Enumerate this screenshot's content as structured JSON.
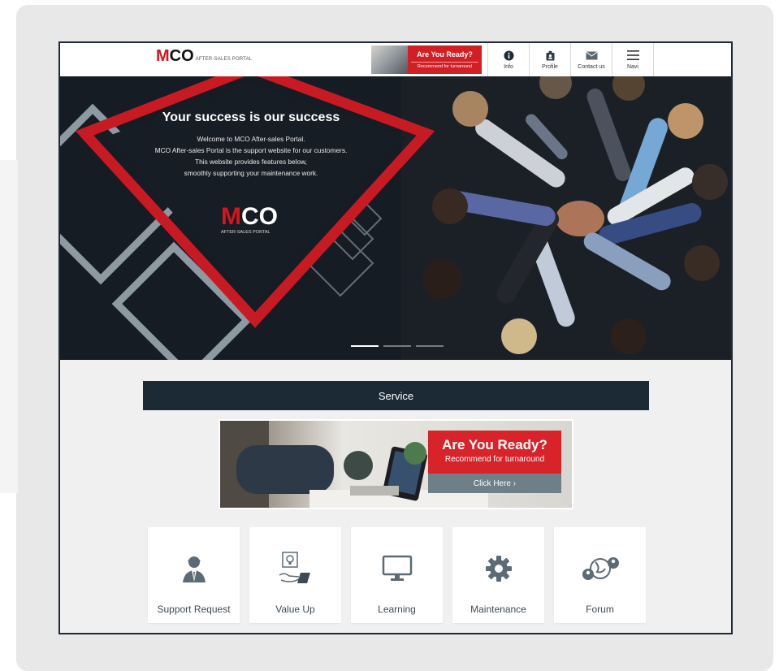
{
  "header": {
    "logo": {
      "m": "M",
      "co": "CO",
      "sub": "AFTER-SALES PORTAL"
    },
    "banner": {
      "title": "Are You Ready?",
      "subtitle": "Recommend for turnaround"
    },
    "nav": [
      {
        "label": "Info",
        "icon": "info-icon"
      },
      {
        "label": "Profile",
        "icon": "profile-icon"
      },
      {
        "label": "Contact us",
        "icon": "mail-icon"
      },
      {
        "label": "Navi",
        "icon": "menu-icon"
      }
    ]
  },
  "hero": {
    "title": "Your success is our success",
    "lines": [
      "Welcome to MCO After-sales Portal.",
      "MCO After-sales Portal is the support website for our customers.",
      "This website provides features below,",
      "smoothly supporting your maintenance work."
    ],
    "logo": {
      "m": "M",
      "co": "CO",
      "sub": "AFTER-SALES PORTAL"
    },
    "slides_count": 3,
    "active_slide": 1
  },
  "service": {
    "title": "Service",
    "promo": {
      "title": "Are You Ready?",
      "subtitle": "Recommend for turnaround",
      "button": "Click Here ›"
    },
    "tiles": [
      {
        "label": "Support Request",
        "icon": "support-agent-icon"
      },
      {
        "label": "Value Up",
        "icon": "lightbulb-hand-icon"
      },
      {
        "label": "Learning",
        "icon": "monitor-icon"
      },
      {
        "label": "Maintenance",
        "icon": "gear-icon"
      },
      {
        "label": "Forum",
        "icon": "globe-chat-icon"
      }
    ]
  },
  "colors": {
    "brand_red": "#d8141c",
    "dark_navy": "#1c2a35",
    "frame_border": "#1e2a38",
    "slate": "#6e7f88"
  }
}
